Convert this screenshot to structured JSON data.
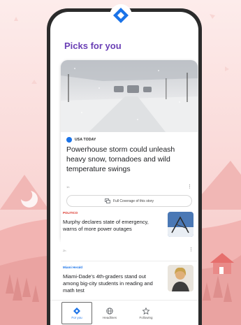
{
  "app": {
    "section_title": "Picks for you"
  },
  "colors": {
    "accent": "#1a73e8",
    "title": "#6a3fb5",
    "politico": "#d93025",
    "miami_source": "#1a73e8",
    "background": "#fbe4e3"
  },
  "icons": {
    "app_logo": "google-news-diamond-icon",
    "coverage": "full-coverage-icon",
    "nav_for_you": "diamond-icon",
    "nav_headlines": "globe-icon",
    "nav_following": "star-icon"
  },
  "featured": {
    "source": "USA TODAY",
    "headline": "Powerhouse storm could unleash heavy snow, tornadoes and wild temperature swings",
    "time": "1h",
    "coverage_label": "Full Coverage of this story"
  },
  "stories": [
    {
      "source": "POLITICO",
      "headline": "Murphy declares state of emergency, warns of more power outages",
      "time": "2h"
    },
    {
      "source": "Miami Herald",
      "headline": "Miami-Dade's 4th-graders stand out among big-city students in reading and math test"
    }
  ],
  "nav": [
    {
      "label": "For you",
      "active": true
    },
    {
      "label": "Headlines",
      "active": false
    },
    {
      "label": "Following",
      "active": false
    }
  ]
}
